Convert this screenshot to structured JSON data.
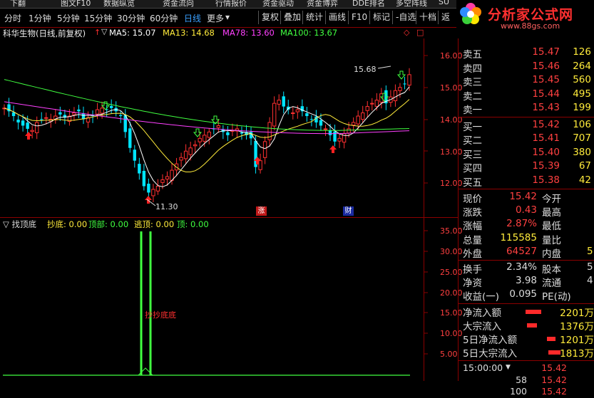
{
  "menubar": {
    "items": [
      "下翻",
      "图文F10",
      "数据纵览",
      "资金流向",
      "行情报价",
      "资金驱动",
      "资金博弈",
      "DDE排名",
      "多空阵线",
      "SU"
    ]
  },
  "tabs": {
    "periods": [
      "分时",
      "1分钟",
      "5分钟",
      "15分钟",
      "30分钟",
      "60分钟",
      "日线",
      "更多"
    ],
    "active_period": "日线",
    "buttons": [
      "复权",
      "叠加",
      "统计",
      "画线",
      "F10",
      "标记",
      "-自选",
      "十档",
      "返"
    ]
  },
  "logo": {
    "name": "分析家公式网",
    "url_text": "www.88gs.com"
  },
  "main_chart": {
    "stock_title": "科华生物(日线,前复权)",
    "ma_labels": [
      {
        "text": "MA5: 15.07",
        "color": "#ffffff"
      },
      {
        "text": "MA13: 14.68",
        "color": "#ffeb3b"
      },
      {
        "text": "MA78: 13.60",
        "color": "#ff40ff"
      },
      {
        "text": "MA100: 13.67",
        "color": "#40ff40"
      }
    ],
    "price_axis": [
      "16.00",
      "15.00",
      "14.00",
      "13.00",
      "12.00"
    ],
    "high_annotation": "15.68",
    "low_annotation": "11.30",
    "marker_zhang": "涨",
    "marker_cai": "财"
  },
  "sub_chart": {
    "title": "找顶底",
    "labels": [
      {
        "text": "抄底: 0.00",
        "color": "#ffeb3b"
      },
      {
        "text": "顶部: 0.00",
        "color": "#40ff40"
      },
      {
        "text": "逃顶: 0.00",
        "color": "#ffeb3b"
      },
      {
        "text": "顶: 0.00",
        "color": "#40ff40"
      }
    ],
    "axis": [
      "35.00",
      "30.00",
      "25.00",
      "20.00",
      "15.00",
      "10.00",
      "5.00"
    ],
    "signal_text": "抄抄底底"
  },
  "quote_panel": {
    "sell": [
      {
        "label": "卖五",
        "price": "15.47",
        "vol": "126"
      },
      {
        "label": "卖四",
        "price": "15.46",
        "vol": "264"
      },
      {
        "label": "卖三",
        "price": "15.45",
        "vol": "560"
      },
      {
        "label": "卖二",
        "price": "15.44",
        "vol": "495"
      },
      {
        "label": "卖一",
        "price": "15.43",
        "vol": "199"
      }
    ],
    "buy": [
      {
        "label": "买一",
        "price": "15.42",
        "vol": "106"
      },
      {
        "label": "买二",
        "price": "15.41",
        "vol": "707"
      },
      {
        "label": "买三",
        "price": "15.40",
        "vol": "380"
      },
      {
        "label": "买四",
        "price": "15.39",
        "vol": "67"
      },
      {
        "label": "买五",
        "price": "15.38",
        "vol": "42"
      }
    ],
    "stats": [
      {
        "l": "现价",
        "v": "15.42",
        "c": "#ff4040",
        "l2": "今开",
        "v2": ""
      },
      {
        "l": "涨跌",
        "v": "0.43",
        "c": "#ff4040",
        "l2": "最高",
        "v2": ""
      },
      {
        "l": "涨幅",
        "v": "2.87%",
        "c": "#ff4040",
        "l2": "最低",
        "v2": ""
      },
      {
        "l": "总量",
        "v": "115585",
        "c": "#ffeb3b",
        "l2": "量比",
        "v2": ""
      },
      {
        "l": "外盘",
        "v": "64527",
        "c": "#ff4040",
        "l2": "内盘",
        "v2": "5"
      }
    ],
    "stats2": [
      {
        "l": "换手",
        "v": "2.34%",
        "c": "#ddd",
        "l2": "股本",
        "v2": "5"
      },
      {
        "l": "净资",
        "v": "3.98",
        "c": "#ddd",
        "l2": "流通",
        "v2": "4"
      },
      {
        "l": "收益(一)",
        "v": "0.095",
        "c": "#ddd",
        "l2": "PE(动)",
        "v2": ""
      }
    ],
    "flows": [
      {
        "label": "净流入额",
        "value": "2201万",
        "bar": 0.9
      },
      {
        "label": "大宗流入",
        "value": "1376万",
        "bar": 0.6
      },
      {
        "label": "5日净流入额",
        "value": "1201万",
        "bar": 0.5
      },
      {
        "label": "5日大宗流入",
        "value": "1813万",
        "bar": 0.7
      }
    ],
    "ticks": [
      {
        "time": "15:00:00",
        "flag": "▼",
        "num": "",
        "price": "15.42"
      },
      {
        "time": "",
        "flag": "",
        "num": "58",
        "price": "15.42"
      },
      {
        "time": "",
        "flag": "",
        "num": "100",
        "price": "15.42"
      }
    ]
  }
}
